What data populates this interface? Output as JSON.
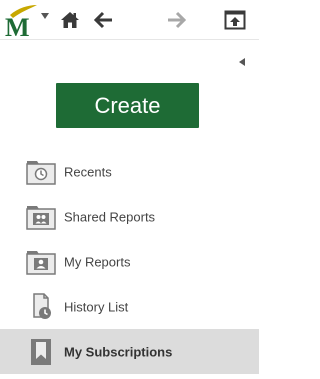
{
  "toolbar": {
    "logo_letter": "M",
    "icons": [
      "logo-icon",
      "dropdown-caret-icon",
      "home-icon",
      "back-arrow-icon",
      "forward-arrow-icon",
      "upload-folder-icon"
    ]
  },
  "panel": {
    "create_label": "Create",
    "nav_items": [
      {
        "label": "Recents",
        "icon": "recents-folder-icon",
        "active": false
      },
      {
        "label": "Shared Reports",
        "icon": "shared-folder-icon",
        "active": false
      },
      {
        "label": "My Reports",
        "icon": "user-folder-icon",
        "active": false
      },
      {
        "label": "History List",
        "icon": "history-list-icon",
        "active": false
      },
      {
        "label": "My Subscriptions",
        "icon": "subscriptions-icon",
        "active": true
      }
    ]
  },
  "colors": {
    "brand_green": "#1e6b35",
    "logo_gold": "#c8a800",
    "icon_gray": "#7a7a7a",
    "active_bg": "#dcdcdc"
  }
}
